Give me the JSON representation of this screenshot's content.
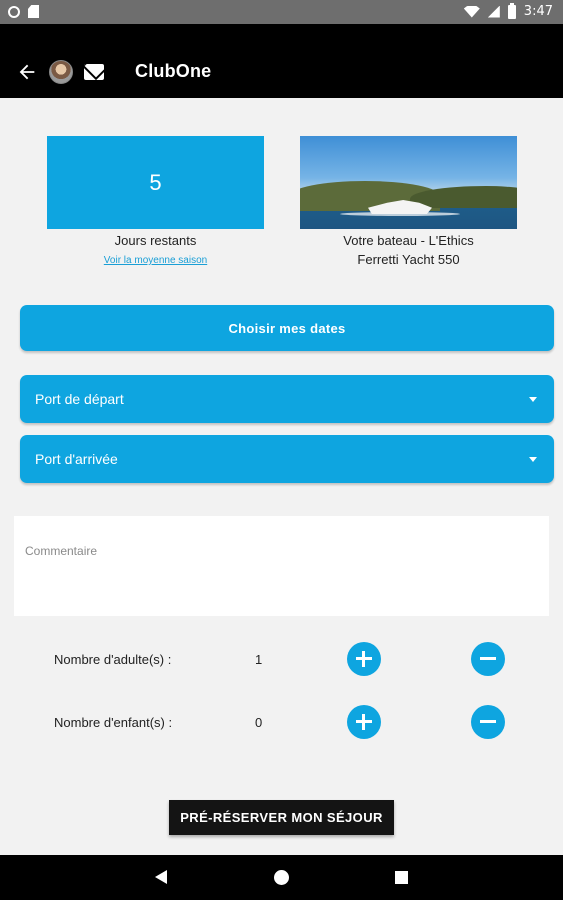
{
  "status_bar": {
    "time": "3:47"
  },
  "app_bar": {
    "title": "ClubOne"
  },
  "days": {
    "value": "5",
    "label": "Jours restants",
    "link": "Voir la moyenne saison"
  },
  "boat": {
    "line1": "Votre bateau - L'Ethics",
    "line2": "Ferretti Yacht 550"
  },
  "dates_button": "Choisir mes dates",
  "port_depart": {
    "label": "Port de départ"
  },
  "port_arrivee": {
    "label": "Port d'arrivée"
  },
  "comment": {
    "placeholder": "Commentaire"
  },
  "adults": {
    "label": "Nombre d'adulte(s) :",
    "value": "1"
  },
  "children": {
    "label": "Nombre d'enfant(s) :",
    "value": "0"
  },
  "book_button": "PRÉ-RÉSERVER MON SÉJOUR",
  "colors": {
    "accent": "#0ea5e0",
    "appbar": "#000000",
    "background": "#f2f2f2"
  }
}
